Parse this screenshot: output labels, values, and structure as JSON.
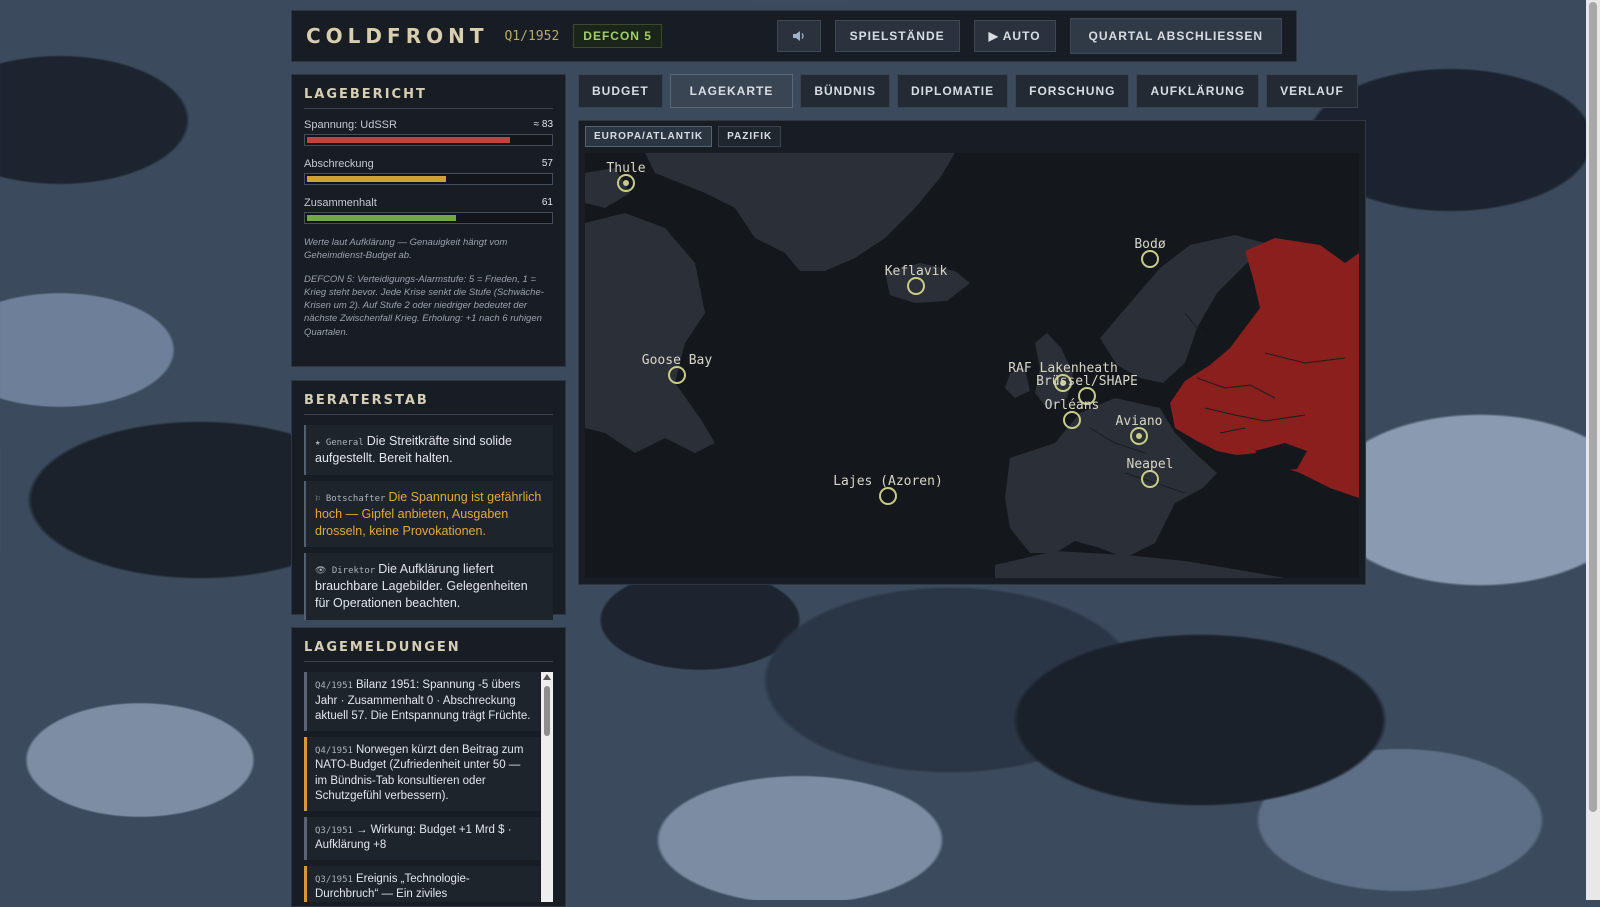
{
  "header": {
    "title": "COLDFRONT",
    "period": "Q1/1952",
    "defcon": "DEFCON 5",
    "sound_icon": "speaker-icon",
    "buttons": {
      "saves": "SPIELSTÄNDE",
      "auto": "▶ AUTO",
      "end_quarter": "QUARTAL ABSCHLIESSEN"
    }
  },
  "situation": {
    "title": "LAGEBERICHT",
    "meters": [
      {
        "label": "Spannung: UdSSR",
        "value": "≈ 83",
        "percent": 83,
        "color": "#c0433f"
      },
      {
        "label": "Abschreckung",
        "value": "57",
        "percent": 57,
        "color": "#c9a531"
      },
      {
        "label": "Zusammenhalt",
        "value": "61",
        "percent": 61,
        "color": "#72a84a"
      }
    ],
    "note1": "Werte laut Aufklärung — Genauigkeit hängt vom Geheimdienst-Budget ab.",
    "note2": "DEFCON 5: Verteidigungs-Alarmstufe: 5 = Frieden, 1 = Krieg steht bevor. Jede Krise senkt die Stufe (Schwäche-Krisen um 2). Auf Stufe 2 oder niedriger bedeutet der nächste Zwischenfall Krieg. Erholung: +1 nach 6 ruhigen Quartalen."
  },
  "advisors": {
    "title": "BERATERSTAB",
    "items": [
      {
        "who": "★ General",
        "msg": "Die Streitkräfte sind solide aufgestellt. Bereit halten.",
        "warn": false
      },
      {
        "who": "⚐ Botschafter",
        "msg": "Die Spannung ist gefährlich hoch — Gipfel anbieten, Ausgaben drosseln, keine Provokationen.",
        "warn": true
      },
      {
        "who": "👁 Direktor",
        "msg": "Die Aufklärung liefert brauchbare Lagebilder. Gelegenheiten für Operationen beachten.",
        "warn": false
      }
    ]
  },
  "feed": {
    "title": "LAGEMELDUNGEN",
    "items": [
      {
        "q": "Q4/1951",
        "text": "Bilanz 1951: Spannung -5 übers Jahr · Zusammenhalt 0 · Abschreckung aktuell 57. Die Entspannung trägt Früchte.",
        "warn": false
      },
      {
        "q": "Q4/1951",
        "text": "Norwegen kürzt den Beitrag zum NATO-Budget (Zufriedenheit unter 50 — im Bündnis-Tab konsultieren oder Schutzgefühl verbessern).",
        "warn": true
      },
      {
        "q": "Q3/1951",
        "text": "→ Wirkung: Budget +1 Mrd $ · Aufklärung +8",
        "warn": false
      },
      {
        "q": "Q3/1951",
        "text": "Ereignis „Technologie-Durchbruch“ — Ein ziviles Forschungsprogramm liefert unerwartet militärisch nutzbare Ergebnisse",
        "warn": true
      }
    ]
  },
  "tabs": [
    "BUDGET",
    "LAGEKARTE",
    "BÜNDNIS",
    "DIPLOMATIE",
    "FORSCHUNG",
    "AUFKLÄRUNG",
    "VERLAUF"
  ],
  "map": {
    "subtabs": [
      "EUROPA/ATLANTIK",
      "PAZIFIK"
    ],
    "bases": [
      {
        "name": "Thule",
        "active": true
      },
      {
        "name": "Keflavik",
        "active": false
      },
      {
        "name": "Bodø",
        "active": false
      },
      {
        "name": "Goose Bay",
        "active": false
      },
      {
        "name": "RAF Lakenheath",
        "active": true
      },
      {
        "name": "Brüssel/SHAPE",
        "active": false
      },
      {
        "name": "Orléans",
        "active": false
      },
      {
        "name": "Aviano",
        "active": true
      },
      {
        "name": "Neapel",
        "active": false
      },
      {
        "name": "Lajes (Azoren)",
        "active": false
      }
    ]
  }
}
